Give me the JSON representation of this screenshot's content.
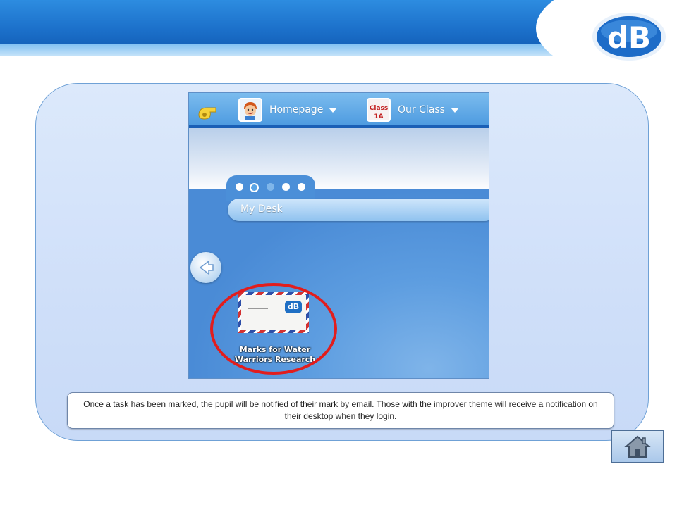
{
  "header": {
    "logo_text": "dB"
  },
  "screenshot": {
    "nav": {
      "items": [
        {
          "label": "Homepage",
          "icon": "avatar-icon"
        },
        {
          "label": "Our Class",
          "icon": "class-icon",
          "thumb_text_top": "Class",
          "thumb_text_bottom": "1A"
        }
      ]
    },
    "carousel": {
      "dot_count": 5,
      "active_index": 1
    },
    "desk": {
      "title": "My Desk"
    },
    "notification": {
      "caption_line1": "Marks for Water",
      "caption_line2": "Warriors Research",
      "stamp_text": "dB"
    }
  },
  "caption": {
    "text": "Once a task has been marked, the pupil will be notified of their mark by email. Those with the improver theme will receive a notification on their desktop when they login."
  },
  "colors": {
    "brand_blue": "#1b6fc9",
    "highlight_red": "#e21d1d"
  }
}
